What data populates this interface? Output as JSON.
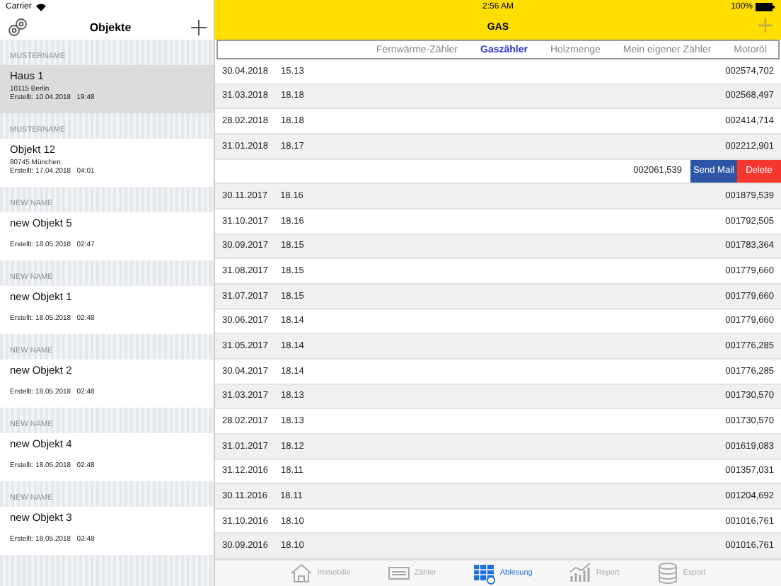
{
  "status_bar": {
    "carrier": "Carrier",
    "time": "2:56 AM",
    "battery": "100%"
  },
  "sidebar": {
    "title": "Objekte",
    "groups": [
      {
        "header": "MUSTERNAME",
        "item": {
          "name": "Haus 1",
          "address": "10115 Berlin",
          "created": "Erstellt: 10.04.2018   19:48",
          "selected": true
        }
      },
      {
        "header": "MUSTERNAME",
        "item": {
          "name": "Objekt 12",
          "address": "80745 München",
          "created": "Erstellt: 17.04.2018   04:01",
          "selected": false
        }
      },
      {
        "header": "NEW NAME",
        "item": {
          "name": "new Objekt 5",
          "created": "Erstellt: 18.05.2018   02:47",
          "selected": false
        }
      },
      {
        "header": "NEW NAME",
        "item": {
          "name": "new Objekt 1",
          "created": "Erstellt: 18.05.2018   02:48",
          "selected": false
        }
      },
      {
        "header": "NEW NAME",
        "item": {
          "name": "new Objekt 2",
          "created": "Erstellt: 18.05.2018   02:48",
          "selected": false
        }
      },
      {
        "header": "NEW NAME",
        "item": {
          "name": "new Objekt 4",
          "created": "Erstellt: 18.05.2018   02:48",
          "selected": false
        }
      },
      {
        "header": "NEW NAME",
        "item": {
          "name": "new Objekt 3",
          "created": "Erstellt: 18.05.2018   02:48",
          "selected": false
        }
      }
    ]
  },
  "detail": {
    "title": "GAS",
    "tabs": [
      {
        "label": "Fernwärme-Zähler",
        "selected": false
      },
      {
        "label": "Gaszähler",
        "selected": true
      },
      {
        "label": "Holzmenge",
        "selected": false
      },
      {
        "label": "Mein eigener Zähler",
        "selected": false
      },
      {
        "label": "Motoröl",
        "selected": false
      }
    ],
    "rows": [
      {
        "date": "30.04.2018",
        "time": "15.13",
        "value": "002574,702"
      },
      {
        "date": "31.03.2018",
        "time": "18.18",
        "value": "002568,497"
      },
      {
        "date": "28.02.2018",
        "time": "18.18",
        "value": "002414,714"
      },
      {
        "date": "31.01.2018",
        "time": "18.17",
        "value": "002212,901"
      },
      {
        "value": "002061,539",
        "swiped": true,
        "actions": [
          "Send Mail",
          "Delete"
        ]
      },
      {
        "date": "30.11.2017",
        "time": "18.16",
        "value": "001879,539"
      },
      {
        "date": "31.10.2017",
        "time": "18.16",
        "value": "001792,505"
      },
      {
        "date": "30.09.2017",
        "time": "18.15",
        "value": "001783,364"
      },
      {
        "date": "31.08.2017",
        "time": "18.15",
        "value": "001779,660"
      },
      {
        "date": "31.07.2017",
        "time": "18.15",
        "value": "001779,660"
      },
      {
        "date": "30.06.2017",
        "time": "18.14",
        "value": "001779,660"
      },
      {
        "date": "31.05.2017",
        "time": "18.14",
        "value": "001776,285"
      },
      {
        "date": "30.04.2017",
        "time": "18.14",
        "value": "001776,285"
      },
      {
        "date": "31.03.2017",
        "time": "18.13",
        "value": "001730,570"
      },
      {
        "date": "28.02.2017",
        "time": "18.13",
        "value": "001730,570"
      },
      {
        "date": "31.01.2017",
        "time": "18.12",
        "value": "001619,083"
      },
      {
        "date": "31.12.2016",
        "time": "18.11",
        "value": "001357,031"
      },
      {
        "date": "30.11.2016",
        "time": "18.11",
        "value": "001204,692"
      },
      {
        "date": "31.10.2016",
        "time": "18.10",
        "value": "001016,761"
      },
      {
        "date": "30.09.2016",
        "time": "18.10",
        "value": "001016,761"
      }
    ]
  },
  "tab_bar": [
    {
      "kind": "house",
      "label": "Immobilie",
      "selected": false
    },
    {
      "kind": "meter",
      "label": "Zähler",
      "selected": false
    },
    {
      "kind": "grid",
      "label": "Ablesung",
      "selected": true
    },
    {
      "kind": "chart",
      "label": "Report",
      "selected": false
    },
    {
      "kind": "database",
      "label": "Export",
      "selected": false
    }
  ]
}
